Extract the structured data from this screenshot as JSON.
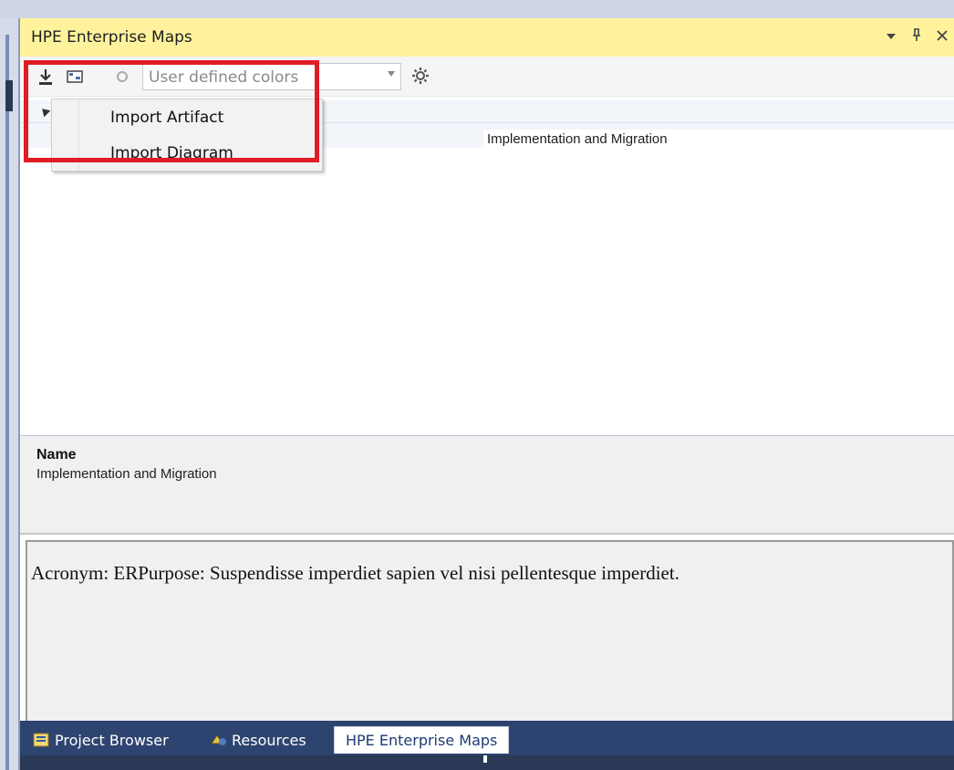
{
  "window": {
    "title": "HPE Enterprise Maps",
    "actions": [
      "dropdown-arrow-icon",
      "pin-icon",
      "close-icon"
    ]
  },
  "toolbar": {
    "import_icon": "download-icon",
    "diagram_icon": "diagram-icon",
    "link_icon": "link-icon",
    "color_mode_value": "User defined colors",
    "settings_icon": "gear-icon"
  },
  "import_menu": {
    "items": [
      {
        "label": "Import Artifact"
      },
      {
        "label": "Import Diagram"
      }
    ]
  },
  "tree": {
    "selected_value": "Implementation and Migration"
  },
  "properties": {
    "name_label": "Name",
    "name_value": "Implementation and Migration"
  },
  "description": {
    "text": "Acronym: ERPurpose: Suspendisse imperdiet sapien vel nisi pellentesque imperdiet."
  },
  "bottom_tabs": [
    {
      "label": "Project Browser",
      "icon": "project-browser-icon",
      "active": false
    },
    {
      "label": "Resources",
      "icon": "resources-icon",
      "active": false
    },
    {
      "label": "HPE Enterprise Maps",
      "icon": "",
      "active": true
    }
  ],
  "colors": {
    "title_bar": "#fff29d",
    "tab_strip": "#2e4470",
    "highlight": "#e01c24"
  }
}
